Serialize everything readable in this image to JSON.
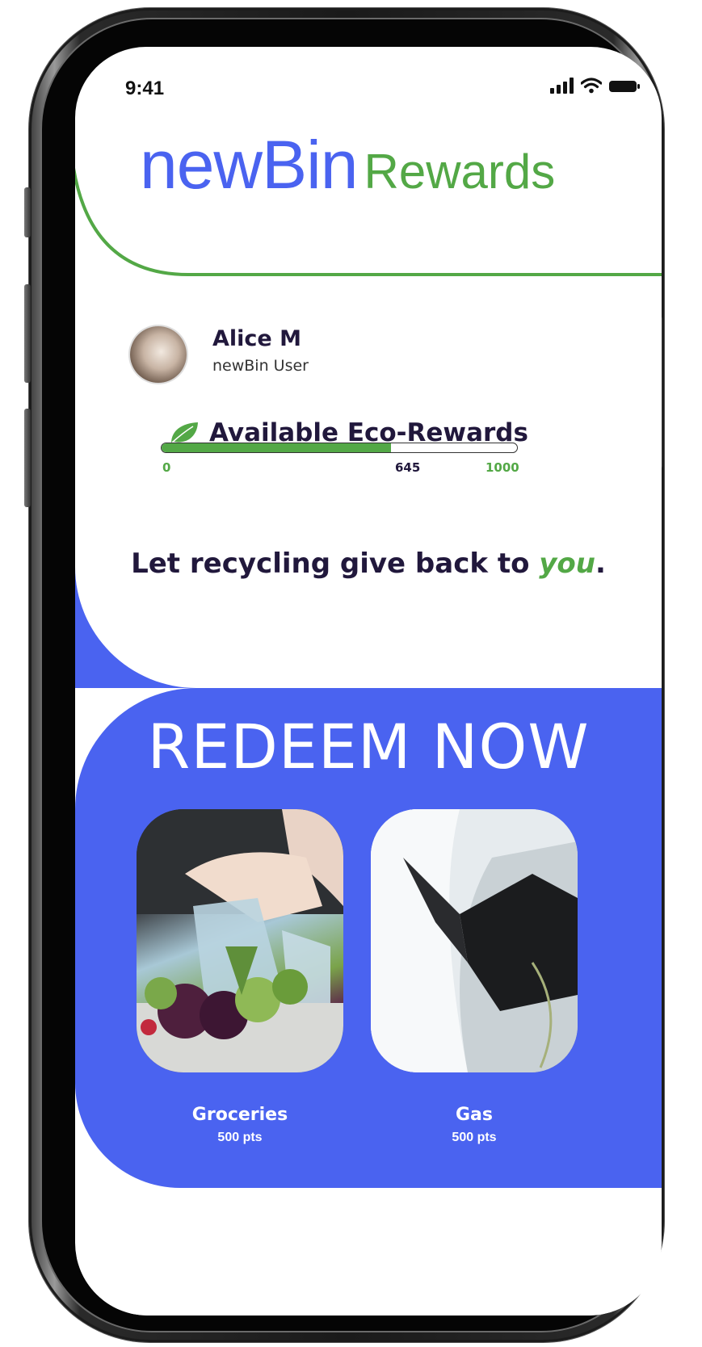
{
  "status_bar": {
    "time": "9:41"
  },
  "header": {
    "brand": "newBin",
    "subtitle": "Rewards"
  },
  "profile": {
    "name": "Alice M",
    "role": "newBin User"
  },
  "eco_rewards": {
    "title": "Available Eco-Rewards",
    "min_label": "0",
    "current_label": "645",
    "max_label": "1000",
    "current": 645,
    "max": 1000
  },
  "tagline": {
    "text": "Let recycling give back to ",
    "emphasis": "you",
    "end": "."
  },
  "redeem": {
    "title": "REDEEM NOW",
    "items": [
      {
        "label": "Groceries",
        "points": "500 pts"
      },
      {
        "label": "Gas",
        "points": "500 pts"
      }
    ]
  },
  "colors": {
    "brand_blue": "#4a63f0",
    "eco_green": "#53a846",
    "ink": "#21183c"
  }
}
